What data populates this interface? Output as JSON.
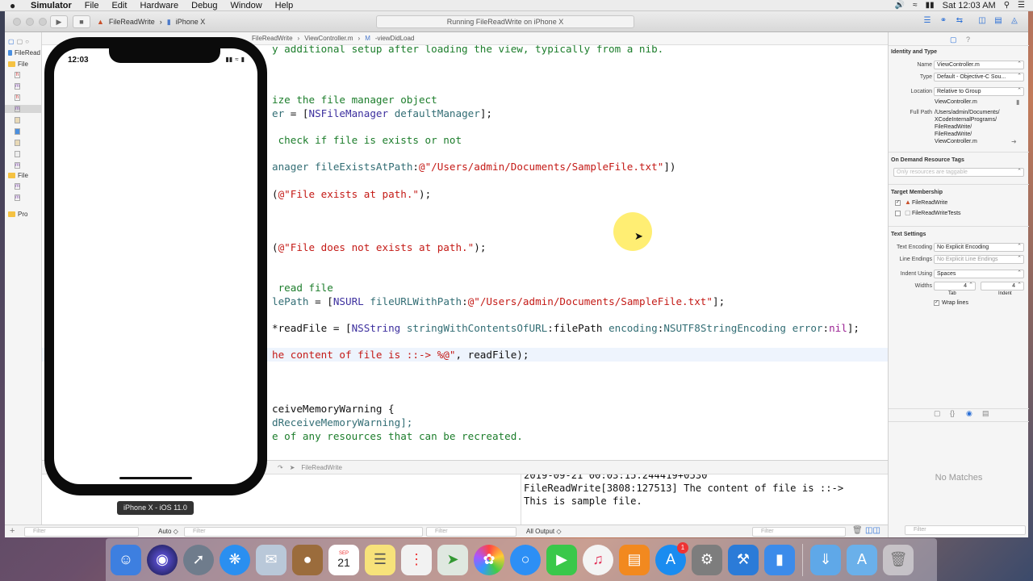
{
  "menubar": {
    "apple": "",
    "items": [
      "Simulator",
      "File",
      "Edit",
      "Hardware",
      "Debug",
      "Window",
      "Help"
    ],
    "clock": "Sat 12:03 AM"
  },
  "toolbar": {
    "scheme_target": "FileReadWrite",
    "scheme_device": "iPhone X",
    "activity": "Running FileReadWrite on iPhone X"
  },
  "navigator": {
    "rows": [
      "FileRead",
      "File",
      "h",
      "m",
      "h",
      "m",
      "",
      "",
      "",
      "File",
      "m",
      "m",
      "Pro"
    ]
  },
  "jumpbar": {
    "crumbs": [
      "FileReadWrite",
      "ViewController.m",
      "-viewDidLoad"
    ]
  },
  "editor": {
    "lines": [
      {
        "t": "y additional setup after loading the view, typically from a nib.",
        "c": "cm"
      },
      {
        "t": "ize the file manager object",
        "c": "cm"
      },
      {
        "t": "er = [NSFileManager defaultManager];"
      },
      {
        "t": " check if file is exists or not",
        "c": "cm"
      },
      {
        "t": "anager fileExistsAtPath:@\"/Users/admin/Documents/SampleFile.txt\"])"
      },
      {
        "t": "(@\"File exists at path.\");"
      },
      {
        "t": "(@\"File does not exists at path.\");"
      },
      {
        "t": " read file",
        "c": "cm"
      },
      {
        "t": "lePath = [NSURL fileURLWithPath:@\"/Users/admin/Documents/SampleFile.txt\"];"
      },
      {
        "t": "*readFile = [NSString stringWithContentsOfURL:filePath encoding:NSUTF8StringEncoding error:nil];"
      },
      {
        "t": "he content of file is ::-> %@\", readFile);"
      },
      {
        "t": "ceiveMemoryWarning {"
      },
      {
        "t": "dReceiveMemoryWarning];"
      },
      {
        "t": "e of any resources that can be recreated.",
        "c": "cm"
      }
    ]
  },
  "debug": {
    "target_label": "FileReadWrite",
    "auto_label": "Auto ◇",
    "filter_placeholder": "Filter",
    "output_label": "All Output ◇"
  },
  "console": {
    "lines": [
      "2019-09-21 00:03:15.244419+0530",
      "FileReadWrite[3808:127513] The content of file is ::->",
      "This is sample file."
    ]
  },
  "inspector": {
    "identity_title": "Identity and Type",
    "name_label": "Name",
    "name_value": "ViewController.m",
    "type_label": "Type",
    "type_value": "Default - Objective-C Sou...",
    "location_label": "Location",
    "location_value": "Relative to Group",
    "location_file": "ViewController.m",
    "fullpath_label": "Full Path",
    "fullpath_lines": [
      "/Users/admin/Documents/",
      "XCodeInternalPrograms/",
      "FileReadWrite/",
      "FileReadWrite/",
      "ViewController.m"
    ],
    "odr_title": "On Demand Resource Tags",
    "odr_placeholder": "Only resources are taggable",
    "membership_title": "Target Membership",
    "targets": [
      "FileReadWrite",
      "FileReadWriteTests"
    ],
    "text_settings_title": "Text Settings",
    "encoding_label": "Text Encoding",
    "encoding_value": "No Explicit Encoding",
    "line_endings_label": "Line Endings",
    "line_endings_value": "No Explicit Line Endings",
    "indent_using_label": "Indent Using",
    "indent_using_value": "Spaces",
    "widths_label": "Widths",
    "tab_value": "4",
    "indent_value": "4",
    "tab_label": "Tab",
    "indent_label": "Indent",
    "wrap_label": "Wrap lines",
    "no_matches": "No Matches"
  },
  "simulator": {
    "time": "12:03",
    "label": "iPhone X - iOS 11.0"
  },
  "dock": {
    "calendar_month": "SEP",
    "calendar_day": "21",
    "appstore_badge": "1"
  }
}
